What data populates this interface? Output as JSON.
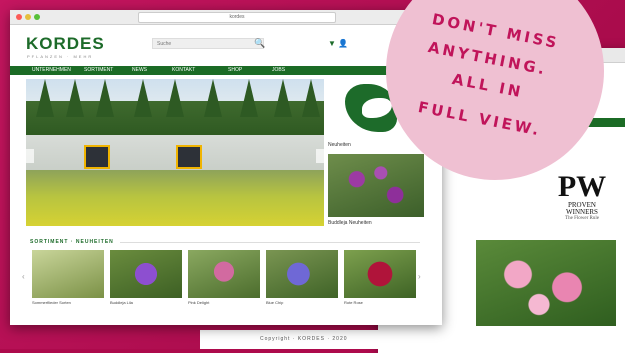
{
  "badge": {
    "line1": "DON'T MISS",
    "line2": "ANYTHING.",
    "line3": "ALL IN",
    "line4": "FULL VIEW."
  },
  "browser": {
    "address": "kordes"
  },
  "site": {
    "logo": "KORDES",
    "logo_sub": "PFLANZEN · MEHR",
    "search_placeholder": "Suche",
    "nav": [
      "UNTERNEHMEN",
      "SORTIMENT",
      "NEWS",
      "KONTAKT",
      "SHOP",
      "JOBS"
    ],
    "section_title": "SORTIMENT · NEUHEITEN",
    "side_caption1": "Neuheiten",
    "side_caption2": "Buddleja Neuheiten",
    "thumbs": [
      {
        "caption": "Sommerflieder Sorten"
      },
      {
        "caption": "Buddleja Lila"
      },
      {
        "caption": "Pink Delight"
      },
      {
        "caption": "Blue Chip"
      },
      {
        "caption": "Rote Rose"
      }
    ]
  },
  "back_site": {
    "pw_big": "PW",
    "pw_line1": "PROVEN",
    "pw_line2": "WINNERS",
    "pw_tiny": "The Flower Rule",
    "footer": "Copyright · KORDES · 2020"
  },
  "colors": {
    "brand_green": "#1d6b2a",
    "magenta_bg": "#ad0a4c",
    "badge_pink": "#efc0d2",
    "badge_text": "#c0145a"
  }
}
